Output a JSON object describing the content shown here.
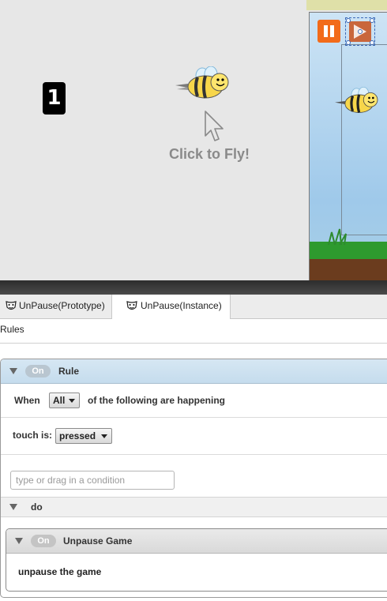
{
  "game": {
    "score": "1",
    "prompt": "Click to Fly!"
  },
  "tabs": [
    {
      "label": "UnPause(Prototype)"
    },
    {
      "label": "UnPause(Instance)"
    }
  ],
  "rules_label": "Rules",
  "rule": {
    "toggle": "On",
    "title": "Rule",
    "when_prefix": "When",
    "match_select": "All",
    "when_suffix": "of the following are happening",
    "condition_label": "touch is:",
    "condition_value": "pressed",
    "condition_placeholder": "type or drag in a condition",
    "do_label": "do"
  },
  "behavior": {
    "toggle": "On",
    "title": "Unpause Game",
    "description": "unpause the game"
  },
  "colors": {
    "rule_header": "#d2e4f1",
    "pause_button": "#f26b1a",
    "divider": "#333333"
  }
}
